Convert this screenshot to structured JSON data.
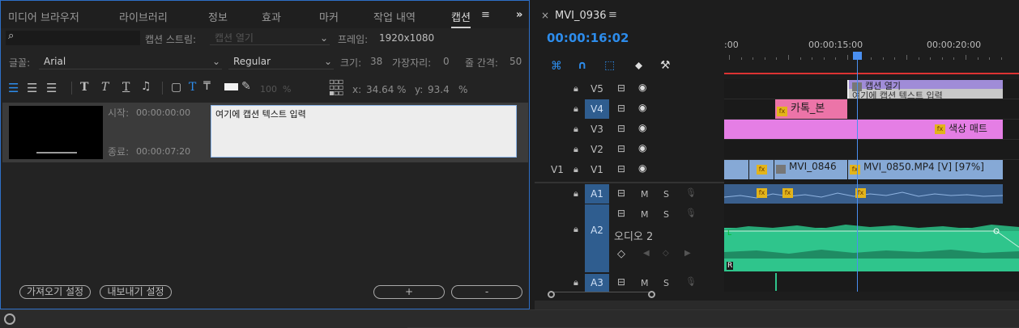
{
  "left_panel": {
    "tabs": [
      "미디어 브라우저",
      "라이브러리",
      "정보",
      "효과",
      "마커",
      "작업 내역",
      "캡션",
      "≡",
      "»"
    ],
    "search_placeholder": "",
    "caption_stream_label": "캡션 스트림:",
    "caption_stream_value": "캡션 열기",
    "frame_label": "프레임:",
    "frame_value": "1920x1080",
    "font_label": "글꼴:",
    "font_value": "Arial",
    "style_value": "Regular",
    "size_label": "크기:",
    "size_value": "38",
    "edge_label": "가장자리:",
    "edge_value": "0",
    "line_spacing_label": "줄 간격:",
    "line_spacing_value": "50",
    "opacity_value": "100",
    "percent": "%",
    "x_label": "x:",
    "x_value": "34.64",
    "y_label": "y:",
    "y_value": "93.4",
    "caption": {
      "start_label": "시작:",
      "start_time": "00:00:00:00",
      "end_label": "종료:",
      "end_time": "00:00:07:20",
      "text": "여기에 캡션 텍스트 입력"
    },
    "import_settings": "가져오기 설정",
    "export_settings": "내보내기 설정",
    "add_label": "+",
    "remove_label": "-"
  },
  "timeline": {
    "sequence_name": "MVI_0936",
    "menu": "≡",
    "close": "×",
    "timecode": "00:00:16:02",
    "ruler": [
      ":00",
      "00:00:15:00",
      "00:00:20:00"
    ],
    "video_tracks": [
      {
        "name": "V5",
        "clip_text": [
          "캡션 열기",
          "여기에 캡션 텍스트 입력"
        ]
      },
      {
        "name": "V4",
        "clip_text": "카톡_본"
      },
      {
        "name": "V3",
        "clip_text": "색상 매트"
      },
      {
        "name": "V2"
      },
      {
        "name": "V1",
        "source": "V1",
        "clips": [
          "MVI_0846",
          "MVI_0850.MP4 [V] [97%]"
        ]
      }
    ],
    "audio_tracks": [
      {
        "name": "A1",
        "m": "M",
        "s": "S"
      },
      {
        "name": "A2",
        "m": "M",
        "s": "S",
        "label": "오디오 2",
        "r": "R"
      },
      {
        "name": "A3",
        "m": "M",
        "s": "S"
      }
    ],
    "colors": {
      "accent": "#2d8ceb",
      "caption_clip": "#a08cd8",
      "pink_clip": "#ec74a8",
      "matte_clip": "#e57ee5",
      "video_clip": "#86a9d6",
      "audio_clip": "#2fc58c",
      "playhead": "#4a8ff0"
    }
  }
}
